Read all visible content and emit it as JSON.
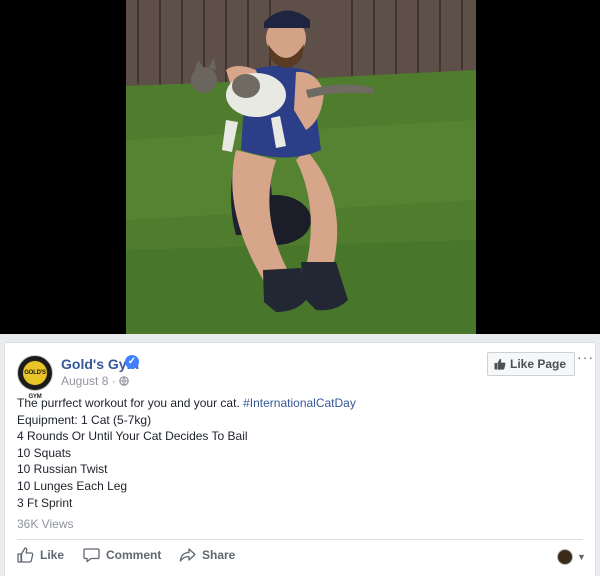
{
  "post": {
    "page_name": "Gold's Gym",
    "date": "August 8",
    "separator": " · ",
    "logo_text": "GOLD'S GYM",
    "like_page_label": "Like Page",
    "more_label": "···",
    "text_intro": "The purrfect workout for you and your cat. ",
    "hashtag": "#InternationalCatDay",
    "lines": [
      "Equipment: 1 Cat (5-7kg)",
      "4 Rounds Or Until Your Cat Decides To Bail",
      "10 Squats",
      "10 Russian Twist",
      "10 Lunges Each Leg",
      "3 Ft Sprint"
    ],
    "views": "36K Views"
  },
  "actions": {
    "like": "Like",
    "comment": "Comment",
    "share": "Share"
  },
  "icons": {
    "verified": "verified-badge-icon",
    "globe": "globe-icon",
    "thumbs_up": "thumbs-up-icon",
    "comment": "comment-bubble-icon",
    "share": "share-arrow-icon"
  },
  "colors": {
    "link": "#365899",
    "verified": "#4080ff",
    "muted": "#90949c",
    "action": "#606770"
  }
}
